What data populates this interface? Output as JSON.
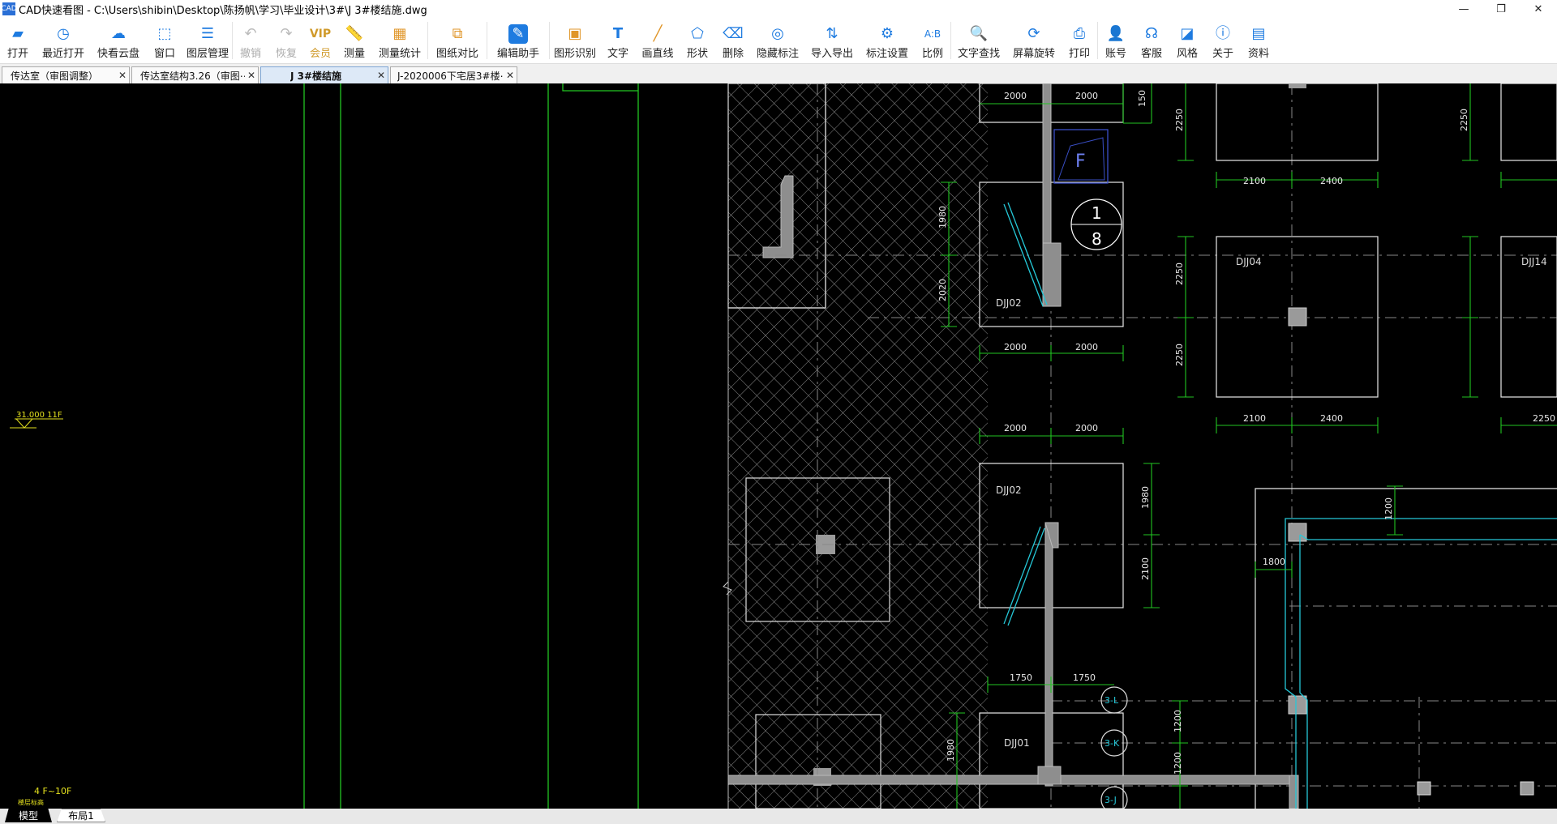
{
  "window": {
    "title": "CAD快速看图 - C:\\Users\\shibin\\Desktop\\陈扬帆\\学习\\毕业设计\\3#\\J 3#楼结施.dwg",
    "app_icon_text": "CAD"
  },
  "toolbar": {
    "open": "打开",
    "recent": "最近打开",
    "cloud": "快看云盘",
    "window": "窗口",
    "layers": "图层管理",
    "undo": "撤销",
    "redo": "恢复",
    "vip": "会员",
    "measure": "测量",
    "measure_stats": "测量统计",
    "compare": "图纸对比",
    "edit_assistant": "编辑助手",
    "shape_recognition": "图形识别",
    "text": "文字",
    "line": "画直线",
    "shape": "形状",
    "erase": "删除",
    "hide_marks": "隐藏标注",
    "import_export": "导入导出",
    "mark_settings": "标注设置",
    "scale": "比例",
    "text_search": "文字查找",
    "screen_rotate": "屏幕旋转",
    "print": "打印",
    "account": "账号",
    "support": "客服",
    "style": "风格",
    "about": "关于",
    "materials": "资料"
  },
  "tabs": [
    {
      "label": "传达室（审图调整）"
    },
    {
      "label": "传达室结构3.26（审图⋯"
    },
    {
      "label": "J 3#楼结施"
    },
    {
      "label": "J-2020006下宅居3#楼⋯"
    }
  ],
  "drawing": {
    "elevation_mark": "31.000 11F",
    "floor_mark": "4 F~10F",
    "floor_mark_sub": "楼层标高",
    "foundations": [
      "DJJ02",
      "DJJ04",
      "DJJ14",
      "DJJ02",
      "DJJ01"
    ],
    "dimensions": [
      "2000",
      "2000",
      "150",
      "2250",
      "2100",
      "2400",
      "2250",
      "1980",
      "2020",
      "2000",
      "2000",
      "2250",
      "2250",
      "2100",
      "2400",
      "2250",
      "2000",
      "2000",
      "1980",
      "2100",
      "1200",
      "1800",
      "1750",
      "1750",
      "1200",
      "1200",
      "1980"
    ],
    "section_mark_top": "1",
    "section_mark_bottom": "8",
    "grid_labels": [
      "3-L",
      "3-K",
      "3-J"
    ],
    "label_F": "F"
  },
  "layout_tabs": {
    "model": "模型",
    "layout1": "布局1"
  }
}
